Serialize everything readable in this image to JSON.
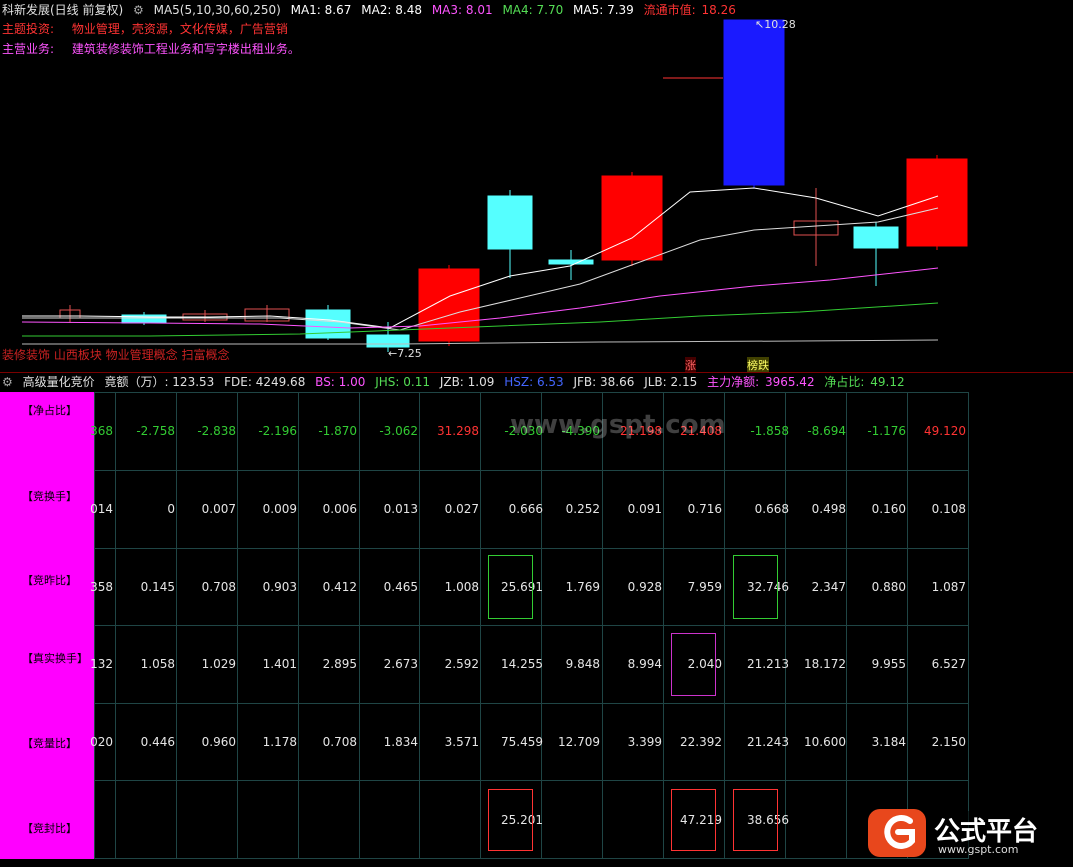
{
  "header": {
    "stock": "科新发展(日线 前复权)",
    "ma_label": "MA5(5,10,30,60,250)",
    "ma1": "MA1: 8.67",
    "ma2": "MA2: 8.48",
    "ma3": "MA3: 8.01",
    "ma4": "MA4: 7.70",
    "ma5": "MA5: 7.39",
    "mcap_label": "流通市值:",
    "mcap_value": "18.26"
  },
  "info": {
    "theme_label": "主题投资:",
    "theme_value": "物业管理，壳资源，文化传媒，广告营销",
    "biz_label": "主营业务:",
    "biz_value": "建筑装修装饰工程业务和写字楼出租业务。",
    "concept_line": "装修装饰 山西板块 物业管理概念 扫富概念"
  },
  "annotations": {
    "high": "10.28",
    "low": "7.25",
    "tag_zhang": "涨",
    "tag_bangdie": "榜跌"
  },
  "indicator_header": {
    "title": "高级量化竞价",
    "jing_e": "竟额（万）: 123.53",
    "fde": "FDE: 4249.68",
    "bs": "BS: 1.00",
    "jhs": "JHS: 0.11",
    "jzb": "JZB: 1.09",
    "hsz": "HSZ: 6.53",
    "jfb": "JFB: 38.66",
    "jlb": "JLB: 2.15",
    "zljg_label": "主力净额:",
    "zljg_value": "3965.42",
    "jzb2_label": "净占比:",
    "jzb2_value": "49.12"
  },
  "table": {
    "row_labels": [
      "【净占比】",
      "【竞换手】",
      "【竞昨比】",
      "【真实换手】",
      "【竞量比】",
      "【竞封比】"
    ],
    "rows": [
      [
        "368",
        "-2.758",
        "-2.838",
        "-2.196",
        "-1.870",
        "-3.062",
        "31.298",
        "-2.030",
        "-4.390",
        "21.198",
        "21.408",
        "-1.858",
        "-8.694",
        "-1.176",
        "49.120"
      ],
      [
        "014",
        "0",
        "0.007",
        "0.009",
        "0.006",
        "0.013",
        "0.027",
        "0.666",
        "0.252",
        "0.091",
        "0.716",
        "0.668",
        "0.498",
        "0.160",
        "0.108"
      ],
      [
        "358",
        "0.145",
        "0.708",
        "0.903",
        "0.412",
        "0.465",
        "1.008",
        "25.691",
        "1.769",
        "0.928",
        "7.959",
        "32.746",
        "2.347",
        "0.880",
        "1.087"
      ],
      [
        "132",
        "1.058",
        "1.029",
        "1.401",
        "2.895",
        "2.673",
        "2.592",
        "14.255",
        "9.848",
        "8.994",
        "2.040",
        "21.213",
        "18.172",
        "9.955",
        "6.527"
      ],
      [
        "020",
        "0.446",
        "0.960",
        "1.178",
        "0.708",
        "1.834",
        "3.571",
        "75.459",
        "12.709",
        "3.399",
        "22.392",
        "21.243",
        "10.600",
        "3.184",
        "2.150"
      ],
      [
        "",
        "",
        "",
        "",
        "",
        "",
        "",
        "25.201",
        "",
        "",
        "47.219",
        "38.656",
        "",
        "",
        ""
      ]
    ],
    "row0_colors": [
      "#33cc33",
      "#33cc33",
      "#33cc33",
      "#33cc33",
      "#33cc33",
      "#33cc33",
      "#ff3333",
      "#33cc33",
      "#33cc33",
      "#ff3333",
      "#ff3333",
      "#33cc33",
      "#33cc33",
      "#33cc33",
      "#ff3333"
    ]
  },
  "watermark": "www.gspt.com",
  "logo": {
    "name": "公式平台",
    "url": "www.gspt.com"
  },
  "colors": {
    "up": "#ff0000",
    "down": "#55ffff",
    "accent": "#ff00ff"
  }
}
